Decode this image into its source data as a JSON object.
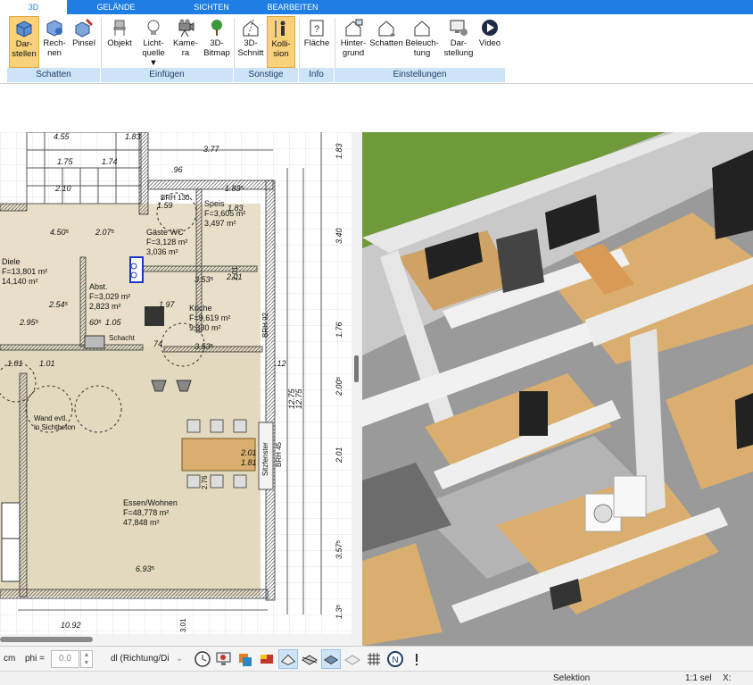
{
  "tabs": [
    {
      "label": "3D",
      "active": true
    },
    {
      "label": "GELÄNDE",
      "active": false
    },
    {
      "label": "SICHTEN",
      "active": false
    },
    {
      "label": "BEARBEITEN",
      "active": false
    }
  ],
  "ribbon": {
    "buttons": [
      {
        "label": "Dar-\nstellen",
        "icon": "cube-icon",
        "active": true
      },
      {
        "label": "Rech-\nnen",
        "icon": "calculate-cube-icon",
        "active": false
      },
      {
        "label": "Pinsel",
        "icon": "brush-cube-icon",
        "active": false
      },
      {
        "label": "Objekt",
        "icon": "chair-icon",
        "active": false
      },
      {
        "label": "Licht-\nquelle ▼",
        "icon": "lightbulb-icon",
        "active": false
      },
      {
        "label": "Kame-\nra",
        "icon": "camera-icon",
        "active": false
      },
      {
        "label": "3D-\nBitmap",
        "icon": "tree-icon",
        "active": false
      },
      {
        "label": "3D-\nSchnitt",
        "icon": "section-house-icon",
        "active": false
      },
      {
        "label": "Kolli-\nsion",
        "icon": "person-collision-icon",
        "active": true
      },
      {
        "label": "Fläche",
        "icon": "area-clipboard-icon",
        "active": false
      },
      {
        "label": "Hinter-\ngrund",
        "icon": "house-background-icon",
        "active": false
      },
      {
        "label": "Schatten",
        "icon": "house-shadow-icon",
        "active": false
      },
      {
        "label": "Beleuch-\ntung",
        "icon": "house-light-icon",
        "active": false
      },
      {
        "label": "Dar-\nstellung",
        "icon": "monitor-settings-icon",
        "active": false
      },
      {
        "label": "Video",
        "icon": "play-icon",
        "active": false
      }
    ],
    "groups": [
      "Schatten",
      "Einfügen",
      "Sonstige",
      "Info",
      "Einstellungen"
    ]
  },
  "plan": {
    "rooms": [
      {
        "name": "Diele",
        "lines": [
          "Diele",
          "F=13,801 m²",
          "14,140 m²"
        ]
      },
      {
        "name": "Abst.",
        "lines": [
          "Abst.",
          "F=3,029 m²",
          "2,823 m²"
        ]
      },
      {
        "name": "Küche",
        "lines": [
          "Küche",
          "F=9,619 m²",
          "9,330 m²"
        ]
      },
      {
        "name": "Speis",
        "lines": [
          "Speis",
          "F=3,605 m²",
          "3,497 m²"
        ]
      },
      {
        "name": "Gäste WC",
        "lines": [
          "Gäste WC",
          "F=3,128 m²",
          "3,036 m²"
        ]
      },
      {
        "name": "Essen/Wohnen",
        "lines": [
          "Essen/Wohnen",
          "F=48,778 m²",
          "47,848 m²"
        ]
      }
    ],
    "dims_top": [
      "3.77",
      "1.83⁵",
      "4.50⁵",
      "2.07⁵",
      "2.10",
      "1.75",
      "2.95⁵",
      "2.54⁵",
      "3.53⁵",
      "3.53⁵",
      "6.93⁵",
      "10.92",
      "1.01",
      "1.01",
      "60⁵",
      "74",
      "1.05",
      "2.01",
      "1.81",
      "1.59",
      "1.83",
      "1.74",
      "1.97",
      "2.01",
      ".96",
      ".12",
      "1.83",
      "4.55"
    ],
    "dims_right": [
      "1.83",
      "3.40",
      "1.76",
      "2.00⁵",
      "2.01",
      "3.57⁵",
      "1.3⁵",
      "12.75",
      "12.75"
    ],
    "labels": [
      "Wand evtl.",
      "in Sichtbeton",
      "BRH 45",
      "Sitzfenster",
      "BRH 130",
      "BRH 92",
      "Schacht",
      "3.01",
      "2.76",
      "2.01"
    ]
  },
  "toolbar": {
    "unit": "cm",
    "phi_label": "phi =",
    "phi_value": "0.0",
    "mode_select": "dl (Richtung/Di",
    "icons": [
      "clock-icon",
      "monitor-camera-icon",
      "layers-icon",
      "paint-icon",
      "view-top-icon",
      "view-iso-icon",
      "view-flat-icon",
      "hatch-icon",
      "grid-icon",
      "north-icon",
      "more-icon"
    ]
  },
  "status": {
    "mode": "Selektion",
    "scale": "1:1 sel",
    "coord": "X:"
  },
  "colors": {
    "accent": "#1e7ee4",
    "active_btn": "#f8d17a",
    "group_bg": "#cde3f7",
    "floor": "#e6dcc2",
    "wood": "#d9ae6e",
    "wall3d": "#b7b7b7",
    "grass": "#6f9a3a"
  }
}
